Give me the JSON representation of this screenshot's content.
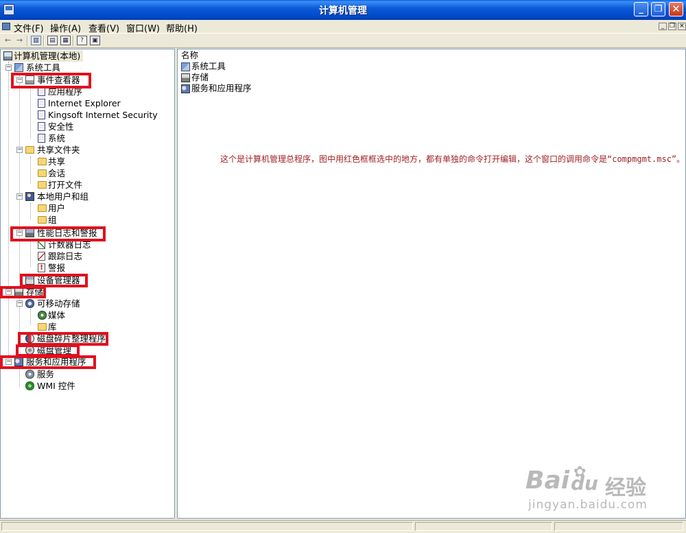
{
  "window": {
    "title": "计算机管理"
  },
  "menu": [
    "文件(F)",
    "操作(A)",
    "查看(V)",
    "窗口(W)",
    "帮助(H)"
  ],
  "titlebar_buttons": {
    "minimize": "_",
    "maximize": "❐",
    "close": "✕"
  },
  "mdi_buttons": {
    "minimize": "_",
    "restore": "❐",
    "close": "×"
  },
  "tree": {
    "root": "计算机管理(本地)",
    "nodes": [
      {
        "label": "系统工具",
        "icon": "tools-icon"
      },
      {
        "label": "事件查看器",
        "icon": "event-viewer-icon"
      },
      {
        "label": "应用程序",
        "icon": "log-icon"
      },
      {
        "label": "Internet Explorer",
        "icon": "log-icon"
      },
      {
        "label": "Kingsoft Internet Security",
        "icon": "log-icon"
      },
      {
        "label": "安全性",
        "icon": "log-icon"
      },
      {
        "label": "系统",
        "icon": "log-icon"
      },
      {
        "label": "共享文件夹",
        "icon": "folder-icon"
      },
      {
        "label": "共享",
        "icon": "folder-icon"
      },
      {
        "label": "会话",
        "icon": "folder-icon"
      },
      {
        "label": "打开文件",
        "icon": "folder-icon"
      },
      {
        "label": "本地用户和组",
        "icon": "users-icon"
      },
      {
        "label": "用户",
        "icon": "folder-icon"
      },
      {
        "label": "组",
        "icon": "folder-icon"
      },
      {
        "label": "性能日志和警报",
        "icon": "performance-icon"
      },
      {
        "label": "计数器日志",
        "icon": "counter-log-icon"
      },
      {
        "label": "跟踪日志",
        "icon": "trace-log-icon"
      },
      {
        "label": "警报",
        "icon": "alert-icon"
      },
      {
        "label": "设备管理器",
        "icon": "device-manager-icon"
      },
      {
        "label": "存储",
        "icon": "storage-icon"
      },
      {
        "label": "可移动存储",
        "icon": "removable-storage-icon"
      },
      {
        "label": "媒体",
        "icon": "media-icon"
      },
      {
        "label": "库",
        "icon": "folder-icon"
      },
      {
        "label": "磁盘碎片整理程序",
        "icon": "defrag-icon"
      },
      {
        "label": "磁盘管理",
        "icon": "disk-management-icon"
      },
      {
        "label": "服务和应用程序",
        "icon": "services-apps-icon"
      },
      {
        "label": "服务",
        "icon": "gear-icon"
      },
      {
        "label": "WMI 控件",
        "icon": "wmi-icon"
      }
    ]
  },
  "list": {
    "column_header": "名称",
    "items": [
      "系统工具",
      "存储",
      "服务和应用程序"
    ]
  },
  "annotation": "这个是计算机管理总程序，图中用红色框框选中的地方，都有单独的命令打开编辑，这个窗口的调用命令是“compmgmt.msc”。",
  "watermark": {
    "brand": "Bai",
    "brand2": "du",
    "cn": "经验",
    "url": "jingyan.baidu.com"
  },
  "colors": {
    "highlight_box": "#e1101e",
    "annotation_text": "#a22222",
    "titlebar": "#0c5bd9"
  }
}
